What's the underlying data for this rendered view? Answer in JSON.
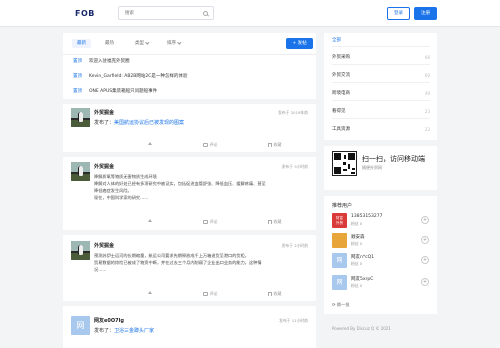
{
  "header": {
    "logo_text": "FOB",
    "search_placeholder": "搜索",
    "login_label": "登录",
    "register_label": "注册"
  },
  "tabs": {
    "items": [
      "最新",
      "最热",
      "类型",
      "排序"
    ],
    "post_label": "+ 发帖"
  },
  "notices": [
    {
      "tag": "置顶",
      "text": "欢迎入驻福克外贸圈"
    },
    {
      "tag": "置顶",
      "text": "Kevin_Garfield: AB2B网站2C是一种怎样的体验"
    },
    {
      "tag": "置顶",
      "text": "ONE APUS集装箱船只问题船事件"
    }
  ],
  "feed": [
    {
      "user": "外贸掘金",
      "time": "发布于 2019年前",
      "action_prefix": "发布了：",
      "action_link": "美国航运协议后已被发现的图案",
      "body": [],
      "likes": "",
      "comments": "评论",
      "favorite": "收藏"
    },
    {
      "user": "外贸掘金",
      "time": "发布于 3小时前",
      "action_prefix": "",
      "action_link": "",
      "body": [
        "降解质氧等物质无害物质生成环境",
        "降解对人体的好处已经有多项研究中被证实，包括促进血管舒张、降低血压、缓解疼痛、甚至",
        "降低癌症发生风险。",
        "现在，中国科学家的研究……"
      ],
      "likes": "",
      "comments": "评论",
      "favorite": "收藏"
    },
    {
      "user": "外贸掘金",
      "time": "发布于 2小时前",
      "action_prefix": "",
      "action_link": "",
      "body": [
        "预测苏伊士运河的长期缩量，航运公司要求先期释放成千上万箱退货至港口的货柜，",
        "贸易数据的惊险已被成了物资中断，并在过去三个月内削弱了企业出口业务的能力，这种情",
        "况……"
      ],
      "likes": "",
      "comments": "评论",
      "favorite": "收藏"
    },
    {
      "user": "网友e0O7lg",
      "avatar_letter": "网",
      "time": "发布于 11小时前",
      "action_prefix": "发布了：",
      "action_link": "卫浴三金蹲头厂家",
      "body": []
    }
  ],
  "categories": [
    {
      "label": "全部",
      "count": ""
    },
    {
      "label": "外贸采购",
      "count": "66"
    },
    {
      "label": "外贸交流",
      "count": "60"
    },
    {
      "label": "跨境电商",
      "count": "49"
    },
    {
      "label": "看得见",
      "count": "23"
    },
    {
      "label": "工具资源",
      "count": "22"
    }
  ],
  "qr": {
    "title": "扫一扫，访问移动端",
    "subtitle": "随便外贸网"
  },
  "recommended": {
    "title": "推荐用户",
    "users": [
      {
        "name": "13853153277",
        "sub": "粉丝 0",
        "avatar_text": "财富\n外贸",
        "color": "#d93a3a"
      },
      {
        "name": "顺安森",
        "sub": "粉丝 0",
        "avatar_text": "",
        "color": "#e8a53a"
      },
      {
        "name": "网友n*cQ1",
        "sub": "粉丝 0",
        "avatar_text": "网",
        "color": "#a8c8ee"
      },
      {
        "name": "网友5xrpC",
        "sub": "粉丝 0",
        "avatar_text": "网",
        "color": "#a8c8ee"
      }
    ],
    "refresh_label": "换一批"
  },
  "footer": {
    "text": "Powered By Discuz Q © 2021"
  },
  "colors": {
    "accent": "#1a73e8",
    "background": "#f3f4f6"
  }
}
